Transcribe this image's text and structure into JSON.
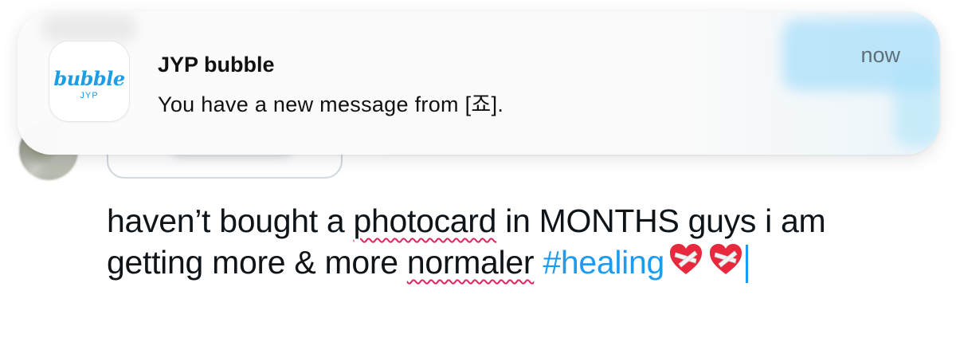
{
  "notification": {
    "app_name": "JYP bubble",
    "message": "You have a new message from [죠].",
    "time": "now",
    "icon": {
      "brand_text": "bubble",
      "sub_text": "JYP",
      "accent_color": "#1c9ee6"
    }
  },
  "composer": {
    "text_before_1": "haven’t bought a ",
    "misspelled_1": "photocard",
    "text_between": " in MONTHS guys i am",
    "text_line2_start": "getting more & more ",
    "misspelled_2": "normaler",
    "hashtag": "#healing",
    "emoji": "mending-heart",
    "emoji_count": 2,
    "hashtag_color": "#1d9bf0",
    "spellcheck_color": "#e0245e"
  }
}
